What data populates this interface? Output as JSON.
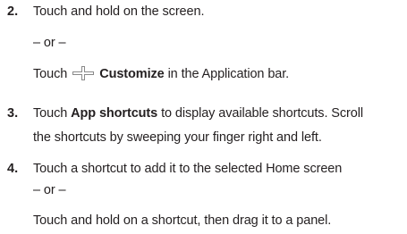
{
  "steps": [
    {
      "number": "2.",
      "line1": "Touch and hold on the screen.",
      "or": "– or –",
      "line3_prefix": "Touch",
      "icon": "customize-plus-icon",
      "line3_bold": "Customize",
      "line3_suffix": "in the Application bar."
    },
    {
      "number": "3.",
      "line1_prefix": "Touch",
      "line1_bold": "App shortcuts",
      "line1_suffix": "to display available shortcuts. Scroll",
      "line2": "the shortcuts by sweeping your finger right and left."
    },
    {
      "number": "4.",
      "line1": "Touch a shortcut to add it to the selected Home screen",
      "or": "– or –",
      "line3": "Touch and hold on a shortcut, then drag it to a panel."
    }
  ]
}
